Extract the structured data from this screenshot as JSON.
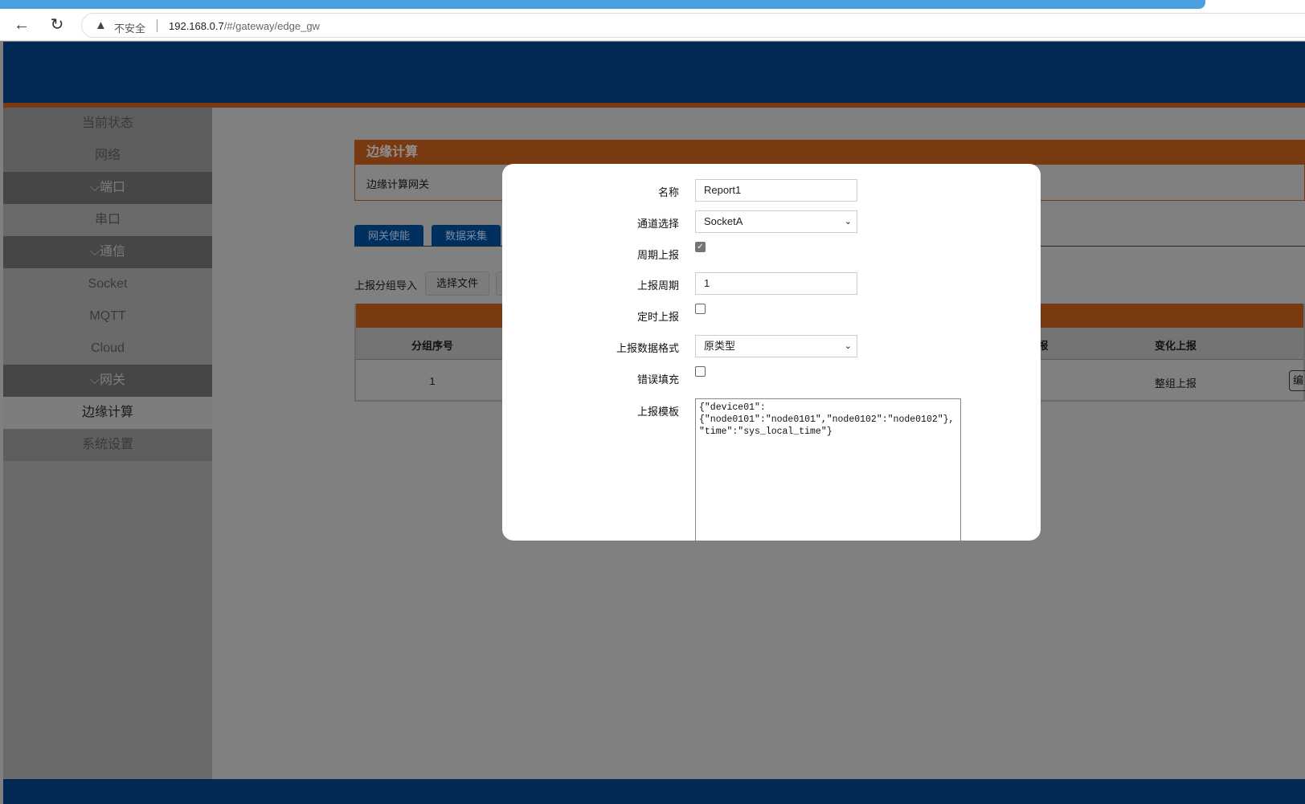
{
  "browser": {
    "security_label": "不安全",
    "url_host": "192.168.0.7",
    "url_path": "/#/gateway/edge_gw"
  },
  "sidebar": {
    "items": [
      {
        "label": "当前状态"
      },
      {
        "label": "网络"
      },
      {
        "label": "⌵端口"
      },
      {
        "label": "串口"
      },
      {
        "label": "⌵通信"
      },
      {
        "label": "Socket"
      },
      {
        "label": "MQTT"
      },
      {
        "label": "Cloud"
      },
      {
        "label": "⌵网关"
      },
      {
        "label": "边缘计算"
      },
      {
        "label": "系统设置"
      }
    ]
  },
  "panel": {
    "title": "边缘计算",
    "subtitle": "边缘计算网关"
  },
  "tabs": [
    "网关使能",
    "数据采集"
  ],
  "import": {
    "label": "上报分组导入",
    "choose_file": "选择文件"
  },
  "table": {
    "headers": {
      "group_no": "分组序号",
      "partial": "报",
      "change_report": "变化上报"
    },
    "rows": [
      {
        "group_no": "1",
        "change_report": "整组上报",
        "edit": "编辑"
      }
    ]
  },
  "modal": {
    "name_label": "名称",
    "name_value": "Report1",
    "channel_label": "通道选择",
    "channel_value": "SocketA",
    "periodic_label": "周期上报",
    "periodic_checked": true,
    "period_label": "上报周期",
    "period_value": "1",
    "timed_label": "定时上报",
    "timed_checked": false,
    "format_label": "上报数据格式",
    "format_value": "原类型",
    "error_fill_label": "错误填充",
    "error_fill_checked": false,
    "template_label": "上报模板",
    "template_value": "{\"device01\":\n{\"node0101\":\"node0101\",\"node0102\":\"node0102\"},\n\"time\":\"sys_local_time\"}"
  }
}
